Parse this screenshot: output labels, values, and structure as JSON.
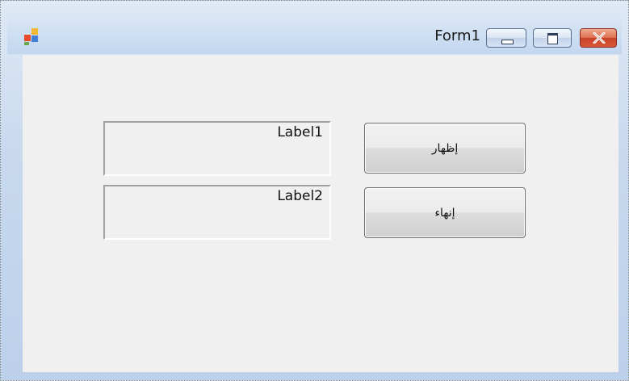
{
  "window": {
    "title": "Form1",
    "accent_close": "#c8422a"
  },
  "labels": [
    {
      "text": "Label1"
    },
    {
      "text": "Label2"
    }
  ],
  "buttons": [
    {
      "text": "إظهار"
    },
    {
      "text": "إنهاء"
    }
  ],
  "icons": {
    "app": "app-icon",
    "minimize": "minimize-icon",
    "maximize": "maximize-icon",
    "close": "close-icon"
  }
}
